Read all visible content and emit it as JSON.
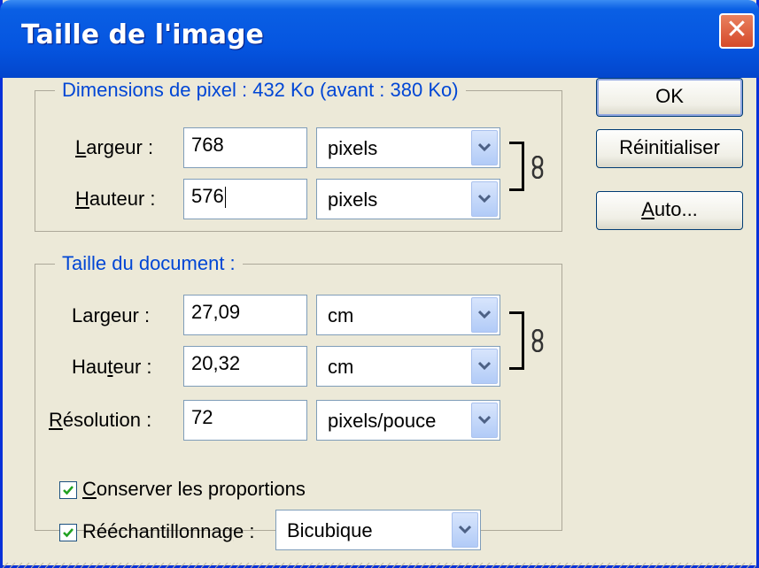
{
  "dialog": {
    "title": "Taille de l'image",
    "close_glyph": "✕"
  },
  "pixel_dimensions": {
    "legend": "Dimensions de pixel :  432 Ko (avant : 380 Ko)",
    "width": {
      "label_pre": "",
      "label_key": "L",
      "label_post": "argeur :",
      "value": "768",
      "unit": "pixels"
    },
    "height": {
      "label_pre": "",
      "label_key": "H",
      "label_post": "auteur :",
      "value": "576",
      "unit": "pixels"
    },
    "link_icon": "chain-link-icon"
  },
  "document_size": {
    "legend": "Taille du document :",
    "width": {
      "label_pre": "Lar",
      "label_key": "g",
      "label_post": "eur :",
      "value": "27,09",
      "unit": "cm"
    },
    "height": {
      "label_pre": "Hau",
      "label_key": "t",
      "label_post": "eur :",
      "value": "20,32",
      "unit": "cm"
    },
    "resolution": {
      "label_pre": "",
      "label_key": "R",
      "label_post": "ésolution :",
      "value": "72",
      "unit": "pixels/pouce"
    },
    "link_icon": "chain-link-icon"
  },
  "options": {
    "constrain": {
      "label_pre": "",
      "label_key": "C",
      "label_post": "onserver les proportions",
      "checked": true
    },
    "resample": {
      "label_pre": "Rééchantillonna",
      "label_key": "g",
      "label_post": "e :",
      "checked": true,
      "method": "Bicubique"
    }
  },
  "buttons": {
    "ok": "OK",
    "reset": "Réinitialiser",
    "auto_pre": "",
    "auto_key": "A",
    "auto_post": "uto..."
  },
  "colors": {
    "titlebar": "#0555e0",
    "legend_text": "#0046d5",
    "dialog_bg": "#ece9d8",
    "close_button": "#d5492a"
  }
}
